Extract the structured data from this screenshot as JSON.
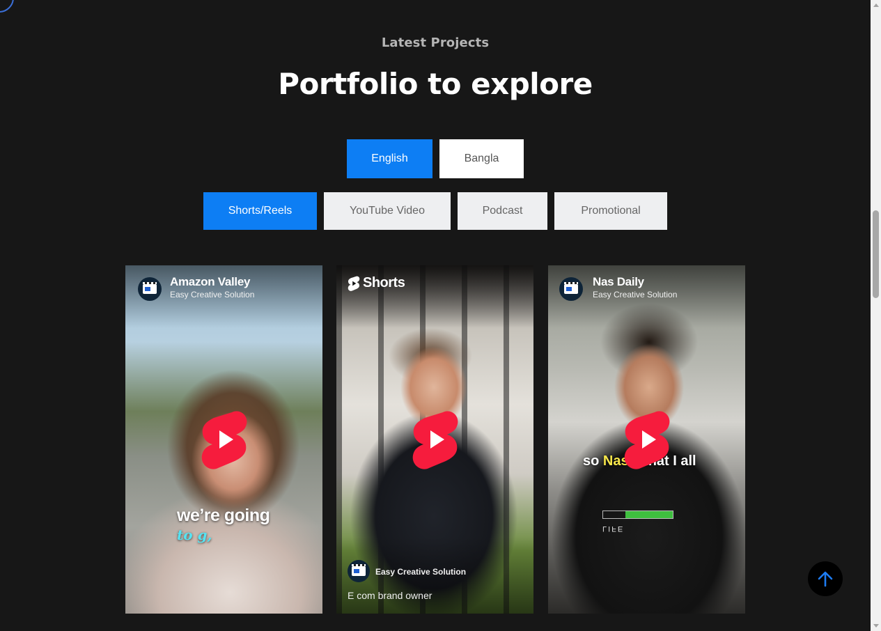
{
  "header": {
    "eyebrow": "Latest Projects",
    "title": "Portfolio to explore"
  },
  "language_tabs": [
    {
      "label": "English",
      "active": true
    },
    {
      "label": "Bangla",
      "active": false
    }
  ],
  "category_tabs": [
    {
      "label": "Shorts/Reels",
      "active": true
    },
    {
      "label": "YouTube Video",
      "active": false
    },
    {
      "label": "Podcast",
      "active": false
    },
    {
      "label": "Promotional",
      "active": false
    }
  ],
  "videos": [
    {
      "title": "Amazon Valley",
      "channel": "Easy Creative Solution",
      "caption_line1": "we’re  going",
      "caption_line2": "to  g,"
    },
    {
      "brand": "Shorts",
      "channel": "Easy Creative Solution",
      "description": "E com brand owner"
    },
    {
      "title": "Nas Daily",
      "channel": "Easy Creative Solution",
      "caption_pre": "so ",
      "caption_highlight": "Nas's",
      "caption_post": " that I all",
      "shirt_text": "LIFE"
    }
  ],
  "colors": {
    "background": "#171717",
    "accent": "#0d7ef4",
    "shorts_red": "#f61c3d",
    "caption_highlight": "#f7e64a",
    "caption_cyan": "#56e3f2"
  },
  "icons": {
    "play": "youtube-shorts-play-icon",
    "back_to_top": "arrow-up-icon"
  }
}
